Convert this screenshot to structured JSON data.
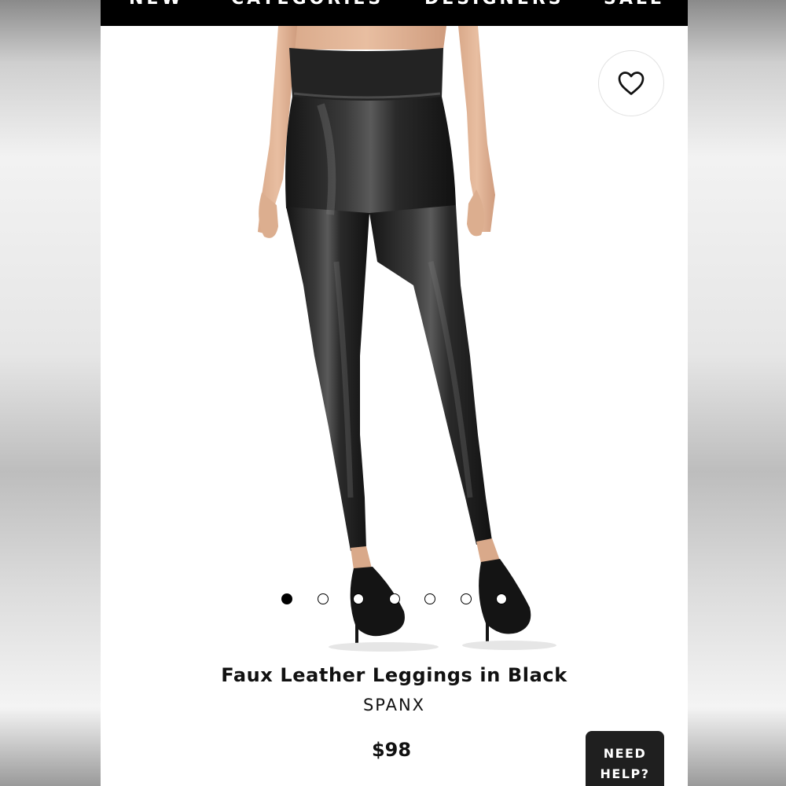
{
  "nav": {
    "items": [
      "NEW",
      "CATEGORIES",
      "DESIGNERS",
      "SALE"
    ]
  },
  "product": {
    "title": "Faux Leather Leggings in Black",
    "brand": "SPANX",
    "price": "$98",
    "image_icon": "product-photo-leggings"
  },
  "carousel": {
    "total": 7,
    "active_index": 0
  },
  "wishlist": {
    "icon": "heart-outline-icon"
  },
  "help": {
    "line1": "NEED",
    "line2": "HELP?"
  },
  "colors": {
    "nav_bg": "#000000",
    "help_bg": "#1f1f1f",
    "leggings": "#1c1c1c"
  }
}
